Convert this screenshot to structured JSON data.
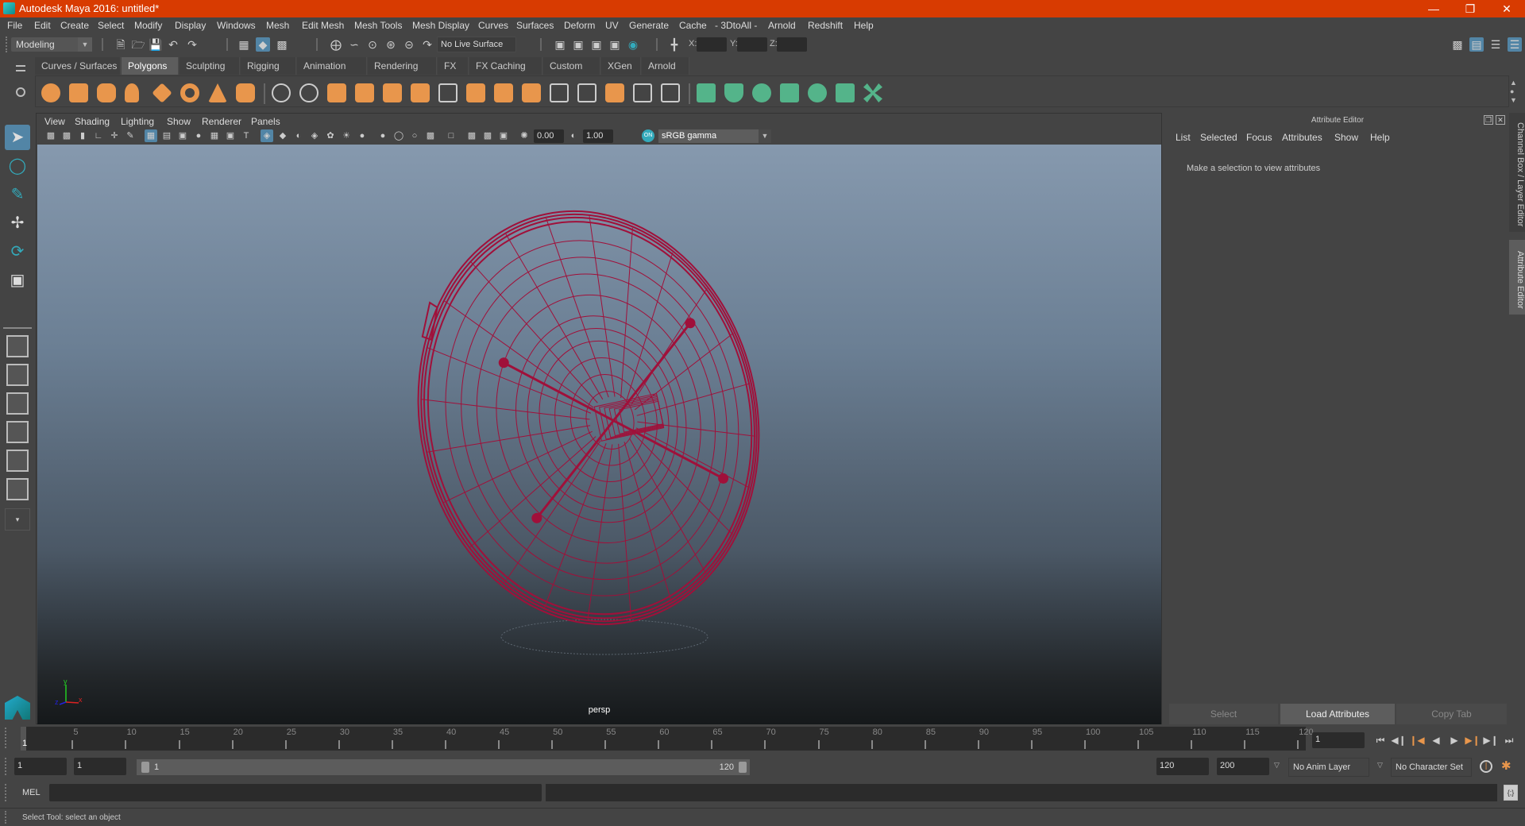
{
  "window": {
    "title": "Autodesk Maya 2016: untitled*",
    "controls": [
      "minimize",
      "restore",
      "close"
    ]
  },
  "menubar": [
    "File",
    "Edit",
    "Create",
    "Select",
    "Modify",
    "Display",
    "Windows",
    "Mesh",
    "Edit Mesh",
    "Mesh Tools",
    "Mesh Display",
    "Curves",
    "Surfaces",
    "Deform",
    "UV",
    "Generate",
    "Cache",
    "- 3DtoAll -",
    "Arnold",
    "Redshift",
    "Help"
  ],
  "statusline": {
    "menuset": "Modeling",
    "live_surface": "No Live Surface",
    "x_label": "X:",
    "y_label": "Y:",
    "z_label": "Z:",
    "x_value": "",
    "y_value": "",
    "z_value": ""
  },
  "shelf": {
    "tabs": [
      "Curves / Surfaces",
      "Polygons",
      "Sculpting",
      "Rigging",
      "Animation",
      "Rendering",
      "FX",
      "FX Caching",
      "Custom",
      "XGen",
      "Arnold"
    ],
    "active_tab": "Polygons",
    "primitive_icons": [
      "poly-sphere",
      "poly-cube",
      "poly-cylinder",
      "poly-cone",
      "poly-plane",
      "poly-torus",
      "poly-pyramid",
      "poly-pipe"
    ],
    "tool_icons": [
      "combine",
      "separate",
      "mirror",
      "smooth",
      "extrude",
      "bridge",
      "multi-cut",
      "bevel",
      "bool",
      "target-weld",
      "append-polygon",
      "fill-hole",
      "make-hole",
      "insert-edgeloop",
      "offset-edgeloop"
    ],
    "uv_icons": [
      "planar-map",
      "cylindrical-map",
      "spherical-map",
      "automatic-map",
      "unfold-uv",
      "uv-editor",
      "uv-layout"
    ]
  },
  "toolbox": {
    "tools": [
      "select-tool",
      "lasso-tool",
      "paint-select-tool",
      "move-tool",
      "rotate-tool",
      "scale-tool"
    ],
    "active": "select-tool"
  },
  "viewport": {
    "menu": [
      "View",
      "Shading",
      "Lighting",
      "Show",
      "Renderer",
      "Panels"
    ],
    "exposure": "0.00",
    "gamma": "1.00",
    "color_space": "sRGB gamma",
    "camera_label": "persp",
    "axis": {
      "x": "x",
      "y": "y",
      "z": "z"
    },
    "wireframe_color": "#a0103a"
  },
  "attribute_editor": {
    "title": "Attribute Editor",
    "menu": [
      "List",
      "Selected",
      "Focus",
      "Attributes",
      "Show",
      "Help"
    ],
    "message": "Make a selection to view attributes",
    "buttons": [
      "Select",
      "Load Attributes",
      "Copy Tab"
    ]
  },
  "side_tabs": [
    "Channel Box / Layer Editor",
    "Attribute Editor"
  ],
  "timeline": {
    "ticks": [
      5,
      10,
      15,
      20,
      25,
      30,
      35,
      40,
      45,
      50,
      55,
      60,
      65,
      70,
      75,
      80,
      85,
      90,
      95,
      100,
      105,
      110,
      115,
      120
    ],
    "current_frame_marker": "1",
    "current_frame_field": "1"
  },
  "range": {
    "start": "1",
    "playback_start": "1",
    "slider_start": "1",
    "slider_end": "120",
    "playback_end": "120",
    "end": "200",
    "anim_layer": "No Anim Layer",
    "character_set": "No Character Set"
  },
  "command_line": {
    "label": "MEL",
    "value": "",
    "result": ""
  },
  "help_line": "Select Tool: select an object",
  "colors": {
    "accent": "#5285a6",
    "titlebar": "#d83b01",
    "shelf_orange": "#e8964c",
    "shelf_green": "#54b48a"
  }
}
